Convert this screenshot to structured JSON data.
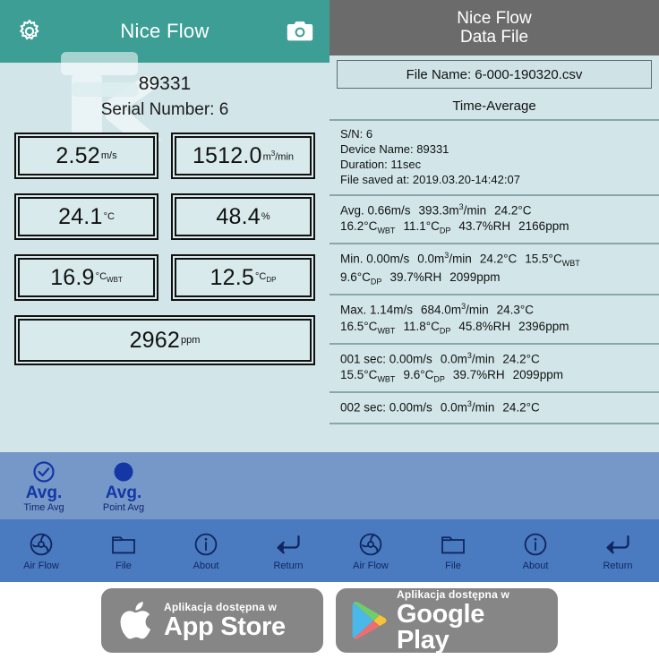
{
  "left_panel": {
    "appbar": {
      "title": "Nice Flow",
      "settings_icon": "gear-icon",
      "camera_icon": "camera-icon"
    },
    "device_id": "89331",
    "serial_label": "Serial Number: 6",
    "watermark": "K",
    "measurements": [
      {
        "value": "2.52",
        "unit": "m/s",
        "unit_kind": "plain"
      },
      {
        "value": "1512.0",
        "unit": "m3/min",
        "unit_kind": "cubic_min"
      },
      {
        "value": "24.1",
        "unit": "°C",
        "unit_kind": "plain"
      },
      {
        "value": "48.4",
        "unit": "%",
        "unit_kind": "plain"
      },
      {
        "value": "16.9",
        "unit": "°C",
        "unit_kind": "sub",
        "sub": "WBT"
      },
      {
        "value": "12.5",
        "unit": "°C",
        "unit_kind": "sub",
        "sub": "DP"
      }
    ],
    "co2": {
      "value": "2962",
      "unit": "ppm"
    },
    "avg_toggle": [
      {
        "main": "Avg.",
        "sub": "Time Avg",
        "icon": "check-circle-icon",
        "selected": false
      },
      {
        "main": "Avg.",
        "sub": "Point Avg",
        "icon": "filled-circle-icon",
        "selected": true
      }
    ],
    "nav": [
      {
        "label": "Air Flow",
        "icon": "fan-icon"
      },
      {
        "label": "File",
        "icon": "folder-icon"
      },
      {
        "label": "About",
        "icon": "info-circle-icon"
      },
      {
        "label": "Return",
        "icon": "return-arrow-icon"
      }
    ]
  },
  "right_panel": {
    "header_line1": "Nice Flow",
    "header_line2": "Data File",
    "file_name": "File Name: 6-000-190320.csv",
    "mode_label": "Time-Average",
    "meta": {
      "sn": "S/N: 6",
      "device_name": "Device Name:  89331",
      "duration": "Duration: 11sec",
      "saved_at": "File saved at: 2019.03.20-14:42:07"
    },
    "records": [
      {
        "id": "avg-record",
        "line1": [
          {
            "t": "Avg. 0.66m/s"
          },
          {
            "t": "393.3m",
            "sup": "3",
            "after": "/min"
          },
          {
            "t": "24.2°C"
          }
        ],
        "line2": [
          {
            "t": "16.2°C",
            "sub": "WBT"
          },
          {
            "t": "11.1°C",
            "sub": "DP"
          },
          {
            "t": "43.7%RH"
          },
          {
            "t": "2166ppm"
          }
        ]
      },
      {
        "id": "min-record",
        "line1": [
          {
            "t": "Min. 0.00m/s"
          },
          {
            "t": "0.0m",
            "sup": "3",
            "after": "/min"
          },
          {
            "t": "24.2°C"
          },
          {
            "t": "15.5°C",
            "sub": "WBT"
          }
        ],
        "line2": [
          {
            "t": "9.6°C",
            "sub": "DP"
          },
          {
            "t": "39.7%RH"
          },
          {
            "t": "2099ppm"
          }
        ]
      },
      {
        "id": "max-record",
        "line1": [
          {
            "t": "Max. 1.14m/s"
          },
          {
            "t": "684.0m",
            "sup": "3",
            "after": "/min"
          },
          {
            "t": "24.3°C"
          }
        ],
        "line2": [
          {
            "t": "16.5°C",
            "sub": "WBT"
          },
          {
            "t": "11.8°C",
            "sub": "DP"
          },
          {
            "t": "45.8%RH"
          },
          {
            "t": "2396ppm"
          }
        ]
      },
      {
        "id": "sec-001-record",
        "line1": [
          {
            "t": "001 sec: 0.00m/s"
          },
          {
            "t": "0.0m",
            "sup": "3",
            "after": "/min"
          },
          {
            "t": "24.2°C"
          }
        ],
        "line2": [
          {
            "t": "15.5°C",
            "sub": "WBT"
          },
          {
            "t": "9.6°C",
            "sub": "DP"
          },
          {
            "t": "39.7%RH"
          },
          {
            "t": "2099ppm"
          }
        ]
      },
      {
        "id": "sec-002-record",
        "line1": [
          {
            "t": "002 sec: 0.00m/s"
          },
          {
            "t": "0.0m",
            "sup": "3",
            "after": "/min"
          },
          {
            "t": "24.2°C"
          }
        ],
        "line2": []
      }
    ],
    "nav": [
      {
        "label": "Air Flow",
        "icon": "fan-icon"
      },
      {
        "label": "File",
        "icon": "folder-icon"
      },
      {
        "label": "About",
        "icon": "info-circle-icon"
      },
      {
        "label": "Return",
        "icon": "return-arrow-icon"
      }
    ]
  },
  "badges": [
    {
      "id": "app-store-badge",
      "small": "Aplikacja dostępna w",
      "big": "App Store",
      "icon": "apple-logo-icon"
    },
    {
      "id": "google-play-badge",
      "small": "Aplikacja dostępna w",
      "big": "Google Play",
      "icon": "google-play-logo-icon"
    }
  ],
  "colors": {
    "teal_header": "#3d9e96",
    "panel_bg": "#d2e6e9",
    "band_blue": "#7598c9",
    "nav_blue": "#4a7ac0",
    "nav_text": "#10275f",
    "grey_header": "#6b6b6b",
    "badge_grey": "#868686"
  }
}
